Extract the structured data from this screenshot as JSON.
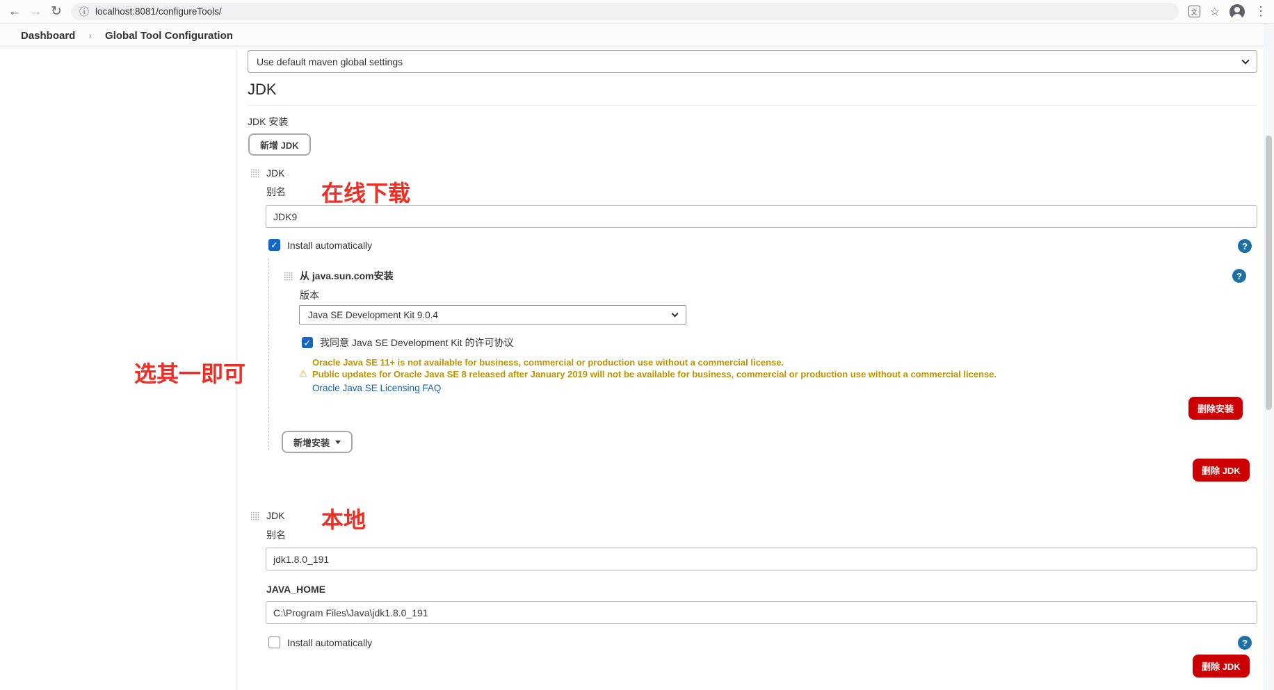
{
  "browser": {
    "url": "localhost:8081/configureTools/"
  },
  "breadcrumb": {
    "dashboard": "Dashboard",
    "current": "Global Tool Configuration"
  },
  "maven": {
    "global_settings_value": "Use default maven global settings"
  },
  "jdk": {
    "section_title": "JDK",
    "installations_label": "JDK 安装",
    "add_jdk_button": "新增 JDK",
    "entries": [
      {
        "type_label": "JDK",
        "alias_label": "别名",
        "alias_value": "JDK9",
        "install_auto_label": "Install automatically",
        "install_auto_checked": true,
        "installer": {
          "title": "从 java.sun.com安装",
          "version_label": "版本",
          "version_value": "Java SE Development Kit 9.0.4",
          "agree_label": "我同意 Java SE Development Kit 的许可协议",
          "agree_checked": true,
          "warning_line1": "Oracle Java SE 11+ is not available for business, commercial or production use without a commercial license.",
          "warning_line2": "Public updates for Oracle Java SE 8 released after January 2019 will not be available for business, commercial or production use without a commercial license.",
          "faq_link": "Oracle Java SE Licensing FAQ",
          "delete_installer_button": "删除安装",
          "add_installer_button": "新增安装"
        },
        "delete_jdk_button": "删除 JDK"
      },
      {
        "type_label": "JDK",
        "alias_label": "别名",
        "alias_value": "jdk1.8.0_191",
        "java_home_label": "JAVA_HOME",
        "java_home_value": "C:\\Program Files\\Java\\jdk1.8.0_191",
        "install_auto_label": "Install automatically",
        "install_auto_checked": false,
        "delete_jdk_button": "删除 JDK"
      }
    ]
  },
  "annotations": {
    "online_download": "在线下载",
    "choose_one": "选其一即可",
    "local": "本地"
  },
  "icons": {
    "back": "←",
    "forward": "→",
    "reload": "↻",
    "info": "ⓘ",
    "translate": "文",
    "star": "☆",
    "kebab": "⋮",
    "check": "✓",
    "question": "?",
    "warning": "⚠",
    "breadcrumb_sep": "›"
  },
  "colors": {
    "danger_red": "#cc0003",
    "checkbox_blue": "#1566c4",
    "help_blue": "#1d6fa5",
    "warning_gold": "#bd9300",
    "link_blue": "#1763a8",
    "annotation_red": "#ee2e24"
  }
}
